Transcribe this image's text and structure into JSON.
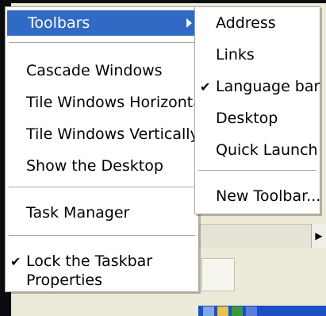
{
  "context_menu": {
    "items": [
      {
        "label": "Toolbars",
        "selected": true,
        "has_submenu": true
      },
      {
        "label": "Cascade Windows"
      },
      {
        "label": "Tile Windows Horizontally"
      },
      {
        "label": "Tile Windows Vertically"
      },
      {
        "label": "Show the Desktop"
      },
      {
        "label": "Task Manager"
      },
      {
        "label": "Lock the Taskbar",
        "checked": true
      },
      {
        "label": "Properties"
      }
    ]
  },
  "toolbars_submenu": {
    "items": [
      {
        "label": "Address"
      },
      {
        "label": "Links"
      },
      {
        "label": "Language bar",
        "checked": true
      },
      {
        "label": "Desktop"
      },
      {
        "label": "Quick Launch"
      },
      {
        "label": "New Toolbar..."
      }
    ]
  },
  "colors": {
    "selection": "#316ac5",
    "menu_bg": "#ffffff",
    "separator": "#aca899"
  },
  "icons": [
    "check-icon",
    "submenu-arrow-icon",
    "scroll-right-icon"
  ]
}
